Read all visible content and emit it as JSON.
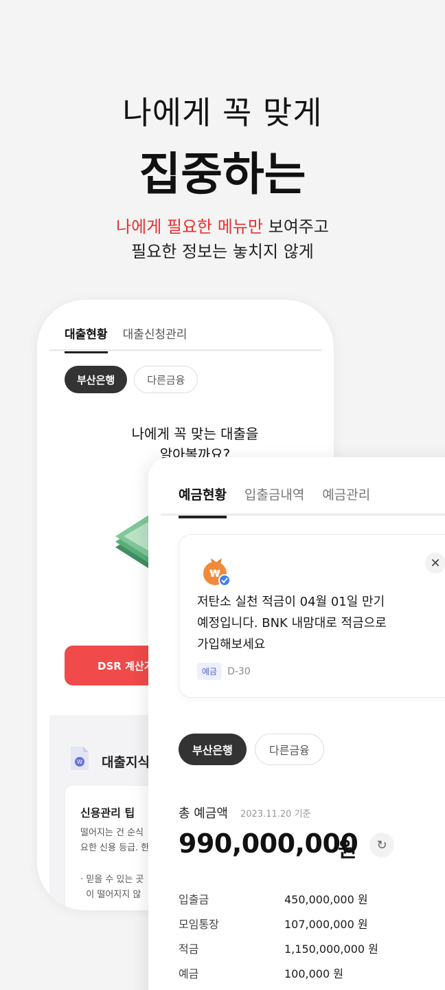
{
  "hero": {
    "line1": "나에게 꼭 맞게",
    "line2": "집중하는",
    "sub_accent": "나에게 필요한 메뉴만",
    "sub_rest": " 보여주고",
    "sub_line2": "필요한 정보는 놓치지 않게"
  },
  "loan_screen": {
    "tabs": [
      "대출현황",
      "대출신청관리"
    ],
    "chips": [
      "부산은행",
      "다른금융"
    ],
    "question_line1": "나에게 꼭 맞는 대출을",
    "question_line2": "알아볼까요?",
    "dsr_button": "DSR 계산기",
    "knowledge_title": "대출지식",
    "tip_title": "신용관리 팁",
    "tip_body_line1": "떨어지는 건 순식",
    "tip_body_line2": "요한 신용 등급. 한",
    "tip_bullet_line1": "믿을 수 있는 곳",
    "tip_bullet_line2": "이 떨어지지 않"
  },
  "deposit_screen": {
    "tabs": [
      "예금현황",
      "입출금내역",
      "예금관리"
    ],
    "notice": {
      "line1": "저탄소 실천 적금이 04월 01일 만기",
      "line2": "예정입니다. BNK 내맘대로 적금으로",
      "line3": "가입해보세요",
      "tag": "예금",
      "dday": "D-30"
    },
    "chips": [
      "부산은행",
      "다른금융"
    ],
    "total_label": "총 예금액",
    "total_date": "2023.11.20 기준",
    "total_amount": "990,000,000",
    "total_unit": "원",
    "breakdown": [
      {
        "name": "입출금",
        "value": "450,000,000 원"
      },
      {
        "name": "모임통장",
        "value": "107,000,000 원"
      },
      {
        "name": "적금",
        "value": "1,150,000,000 원"
      },
      {
        "name": "예금",
        "value": "100,000 원"
      }
    ]
  },
  "colors": {
    "accent": "#e8312f",
    "dsr_button": "#f04a4a",
    "dark_chip": "#333333",
    "tag_bg": "#eef0fb",
    "tag_text": "#5860c9"
  }
}
